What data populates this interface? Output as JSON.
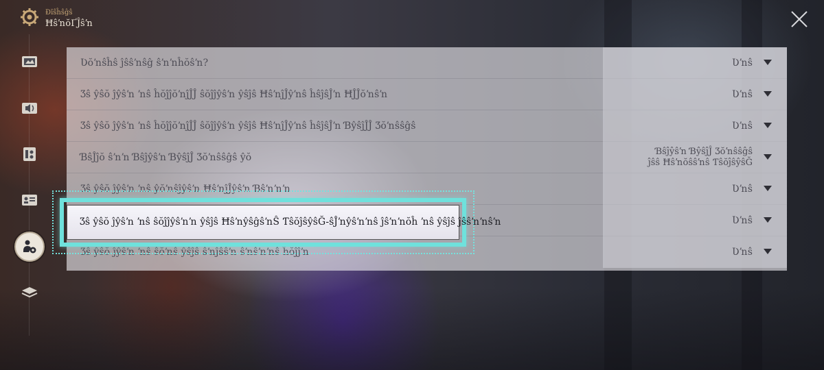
{
  "header": {
    "eyebrow": "Ðĭŝĥŝĝŝ",
    "title": "ĦŝŉŏҐĴŝŉ"
  },
  "sidebar": {
    "items": [
      {
        "icon": "display-icon"
      },
      {
        "icon": "audio-icon"
      },
      {
        "icon": "controls-icon"
      },
      {
        "icon": "account-icon"
      },
      {
        "icon": "accessibility-icon",
        "active": true
      },
      {
        "icon": "layers-icon"
      }
    ]
  },
  "settings": {
    "rows": [
      {
        "label": "Ʋŏŉŝĥŝ ĵŝŝŉŝĝ ŝŉŉĥŏŝŉ?",
        "value": "Ʋŉŝ"
      },
      {
        "label": "Ʒŝ ŷŝŏ ĵŷŝŉ ŉŝ ĥŏĵĵŏŉĵĴĴ ŝŏĵĵŷŝŉ ŷŝĵŝ ĦŝŉĵĴŷŉŝ ĥŝĵŝĴŉ ĦĴĴŏŉŝŉ",
        "value": "Ʋŉŝ"
      },
      {
        "label": "Ʒŝ ŷŝŏ ĵŷŝŉ ŉŝ ĥŏĵĵŏŉĵĴĴ ŝŏĵĵŷŝŉ ŷŝĵŝ ĦŝŉĵĴŷŉŝ ĥŝĵŝĴŉ ƁŷŝĵĴĴ Ʒŏŉŝŝĝŝ",
        "value": "Ʋŉŝ"
      },
      {
        "label": "ƁŝĴĵŏ ŝŉŉ Ɓŝĵŷŝŉ ƁŷŝĵĴ Ʒŏŉŝŝĝŝ ŷŏ",
        "value_lines": [
          "Ɓŝĵŷŝŉ ƁŷŝĵĴ Ʒŏŉŝŝĝŝ",
          "ĵŝŝ Ħŝŉŏŝŝŉŝ ƬŝŏĵŝŷŝĞ"
        ]
      },
      {
        "label": "Ʒŝ ŷŝŏ ĵŷŝŉ ŉŝ ŷŏŉŝĵŷŝŉ ĦŝŉĵĴŷŝŉ Ɓŝŉŉŉ",
        "value": "Ʋŉŝ"
      },
      {
        "label": "Ʒŝ ŷŝŏ ĵŷŝŉ ŉŝ ŝŏĵĵŷŝŉŉ ŷŝĵŝ ĦŝŉŷŝĝŝŉŜ ƬŝŏĵŝŷŝĞ-ŝĴŉŷŝŉŉŝ ĵŝŉŉŏĥ ŉŝ ŷŝĵŝ ĵŝŝŉŉŝŉ",
        "value": "Ʋŉŝ",
        "highlighted": true
      },
      {
        "label": "Ʒŝ ŷŝŏ ĵŷŝŉ ŉŝ ŝŏŉŝ ŷŝĵŝ ŝŉĵŝŝŉ ŝŉŝŉŉŝ ĥŏĵĵŉ",
        "value": "Ʋŉŝ"
      }
    ]
  },
  "colors": {
    "highlight": "#6fe1dc",
    "panel": "#e8e6ea",
    "accent_gold": "#c8a878"
  }
}
